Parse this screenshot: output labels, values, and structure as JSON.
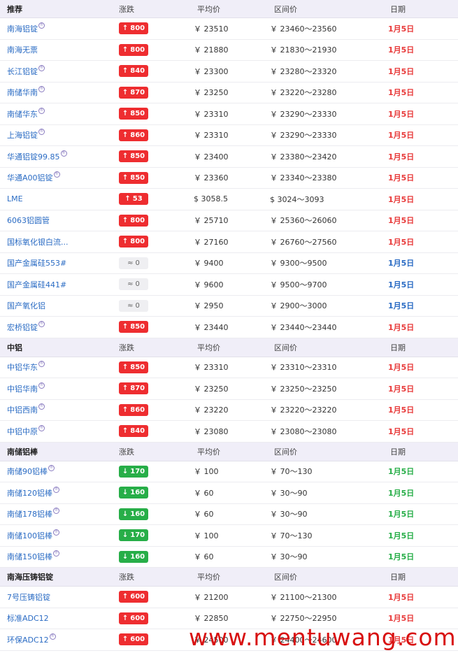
{
  "sections": [
    {
      "header": {
        "name": "推荐",
        "change": "涨跌",
        "avg": "平均价",
        "range": "区间价",
        "date": "日期"
      },
      "rows": [
        {
          "name": "南海铝锭",
          "reg": true,
          "dir": "up",
          "arrow": "↑",
          "change": "800",
          "avg": "￥ 23510",
          "range": "￥ 23460～23560",
          "date": "1月5日"
        },
        {
          "name": "南海无票",
          "reg": false,
          "dir": "up",
          "arrow": "↑",
          "change": "800",
          "avg": "￥ 21880",
          "range": "￥ 21830～21930",
          "date": "1月5日"
        },
        {
          "name": "长江铝锭",
          "reg": true,
          "dir": "up",
          "arrow": "↑",
          "change": "840",
          "avg": "￥ 23300",
          "range": "￥ 23280～23320",
          "date": "1月5日"
        },
        {
          "name": "南储华南",
          "reg": true,
          "dir": "up",
          "arrow": "↑",
          "change": "870",
          "avg": "￥ 23250",
          "range": "￥ 23220～23280",
          "date": "1月5日"
        },
        {
          "name": "南储华东",
          "reg": true,
          "dir": "up",
          "arrow": "↑",
          "change": "850",
          "avg": "￥ 23310",
          "range": "￥ 23290～23330",
          "date": "1月5日"
        },
        {
          "name": "上海铝锭",
          "reg": true,
          "dir": "up",
          "arrow": "↑",
          "change": "860",
          "avg": "￥ 23310",
          "range": "￥ 23290～23330",
          "date": "1月5日"
        },
        {
          "name": "华通铝锭99.85",
          "reg": true,
          "dir": "up",
          "arrow": "↑",
          "change": "850",
          "avg": "￥ 23400",
          "range": "￥ 23380～23420",
          "date": "1月5日"
        },
        {
          "name": "华通A00铝锭",
          "reg": true,
          "dir": "up",
          "arrow": "↑",
          "change": "850",
          "avg": "￥ 23360",
          "range": "￥ 23340～23380",
          "date": "1月5日"
        },
        {
          "name": "LME",
          "reg": false,
          "dir": "up",
          "arrow": "↑",
          "change": "53",
          "avg": "$ 3058.5",
          "range": "$ 3024～3093",
          "date": "1月5日"
        },
        {
          "name": "6063铝圆管",
          "reg": false,
          "dir": "up",
          "arrow": "↑",
          "change": "800",
          "avg": "￥ 25710",
          "range": "￥ 25360～26060",
          "date": "1月5日"
        },
        {
          "name": "国标氧化银白流...",
          "reg": false,
          "dir": "up",
          "arrow": "↑",
          "change": "800",
          "avg": "￥ 27160",
          "range": "￥ 26760～27560",
          "date": "1月5日"
        },
        {
          "name": "国产金属硅553#",
          "reg": false,
          "dir": "flat",
          "arrow": "≈",
          "change": "0",
          "avg": "￥ 9400",
          "range": "￥ 9300～9500",
          "date": "1月5日"
        },
        {
          "name": "国产金属硅441#",
          "reg": false,
          "dir": "flat",
          "arrow": "≈",
          "change": "0",
          "avg": "￥ 9600",
          "range": "￥ 9500～9700",
          "date": "1月5日"
        },
        {
          "name": "国产氧化铝",
          "reg": false,
          "dir": "flat",
          "arrow": "≈",
          "change": "0",
          "avg": "￥ 2950",
          "range": "￥ 2900～3000",
          "date": "1月5日"
        },
        {
          "name": "宏桥铝锭",
          "reg": true,
          "dir": "up",
          "arrow": "↑",
          "change": "850",
          "avg": "￥ 23440",
          "range": "￥ 23440～23440",
          "date": "1月5日"
        }
      ]
    },
    {
      "header": {
        "name": "中铝",
        "change": "涨跌",
        "avg": "平均价",
        "range": "区间价",
        "date": "日期"
      },
      "rows": [
        {
          "name": "中铝华东",
          "reg": true,
          "dir": "up",
          "arrow": "↑",
          "change": "850",
          "avg": "￥ 23310",
          "range": "￥ 23310～23310",
          "date": "1月5日"
        },
        {
          "name": "中铝华南",
          "reg": true,
          "dir": "up",
          "arrow": "↑",
          "change": "870",
          "avg": "￥ 23250",
          "range": "￥ 23250～23250",
          "date": "1月5日"
        },
        {
          "name": "中铝西南",
          "reg": true,
          "dir": "up",
          "arrow": "↑",
          "change": "860",
          "avg": "￥ 23220",
          "range": "￥ 23220～23220",
          "date": "1月5日"
        },
        {
          "name": "中铝中原",
          "reg": true,
          "dir": "up",
          "arrow": "↑",
          "change": "840",
          "avg": "￥ 23080",
          "range": "￥ 23080～23080",
          "date": "1月5日"
        }
      ]
    },
    {
      "header": {
        "name": "南储铝棒",
        "change": "涨跌",
        "avg": "平均价",
        "range": "区间价",
        "date": "日期"
      },
      "rows": [
        {
          "name": "南储90铝棒",
          "reg": true,
          "dir": "down",
          "arrow": "↓",
          "change": "170",
          "avg": "￥ 100",
          "range": "￥ 70～130",
          "date": "1月5日"
        },
        {
          "name": "南储120铝棒",
          "reg": true,
          "dir": "down",
          "arrow": "↓",
          "change": "160",
          "avg": "￥ 60",
          "range": "￥ 30～90",
          "date": "1月5日"
        },
        {
          "name": "南储178铝棒",
          "reg": true,
          "dir": "down",
          "arrow": "↓",
          "change": "160",
          "avg": "￥ 60",
          "range": "￥ 30～90",
          "date": "1月5日"
        },
        {
          "name": "南储100铝棒",
          "reg": true,
          "dir": "down",
          "arrow": "↓",
          "change": "170",
          "avg": "￥ 100",
          "range": "￥ 70～130",
          "date": "1月5日"
        },
        {
          "name": "南储150铝棒",
          "reg": true,
          "dir": "down",
          "arrow": "↓",
          "change": "160",
          "avg": "￥ 60",
          "range": "￥ 30～90",
          "date": "1月5日"
        }
      ]
    },
    {
      "header": {
        "name": "南海压铸铝锭",
        "change": "涨跌",
        "avg": "平均价",
        "range": "区间价",
        "date": "日期"
      },
      "rows": [
        {
          "name": "7号压铸铝锭",
          "reg": false,
          "dir": "up",
          "arrow": "↑",
          "change": "600",
          "avg": "￥ 21200",
          "range": "￥ 21100～21300",
          "date": "1月5日"
        },
        {
          "name": "标准ADC12",
          "reg": false,
          "dir": "up",
          "arrow": "↑",
          "change": "600",
          "avg": "￥ 22850",
          "range": "￥ 22750～22950",
          "date": "1月5日"
        },
        {
          "name": "环保ADC12",
          "reg": true,
          "dir": "up",
          "arrow": "↑",
          "change": "600",
          "avg": "￥ 24500",
          "range": "￥ 24400～24600",
          "date": "1月5日"
        }
      ]
    }
  ],
  "reg_mark": "®",
  "watermark": "www.mentuwang.com",
  "colors": {
    "up": "#ee2d30",
    "down": "#27ae48",
    "flat": "#2b6cc4",
    "header_bg": "#f0eef8",
    "link": "#2b6cc4"
  }
}
